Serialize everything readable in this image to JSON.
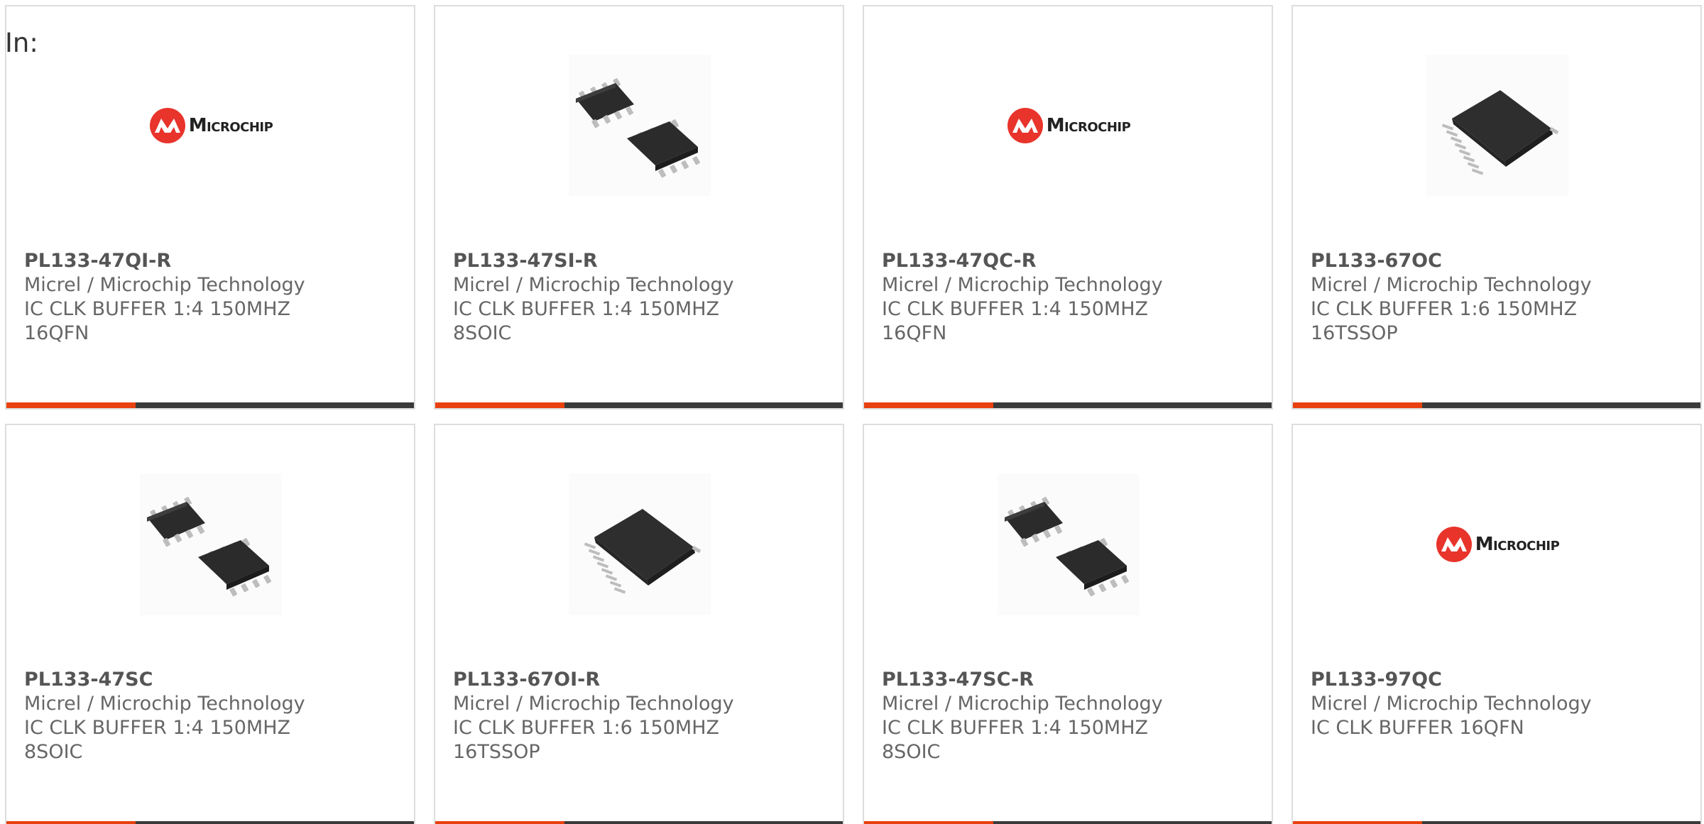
{
  "heading": "In:",
  "colors": {
    "accent": "#e8400f",
    "bar": "#3a3a3a",
    "border": "#dddddd",
    "text": "#666666"
  },
  "products": [
    {
      "part": "PL133-47QI-R",
      "manufacturer": "Micrel / Microchip Technology",
      "desc1": "IC CLK BUFFER 1:4 150MHZ",
      "desc2": "16QFN",
      "image": "microchip-logo",
      "logo_text": "Microchip"
    },
    {
      "part": "PL133-47SI-R",
      "manufacturer": "Micrel / Microchip Technology",
      "desc1": "IC CLK BUFFER 1:4 150MHZ",
      "desc2": "8SOIC",
      "image": "soic8-chip"
    },
    {
      "part": "PL133-47QC-R",
      "manufacturer": "Micrel / Microchip Technology",
      "desc1": "IC CLK BUFFER 1:4 150MHZ",
      "desc2": "16QFN",
      "image": "microchip-logo",
      "logo_text": "Microchip"
    },
    {
      "part": "PL133-67OC",
      "manufacturer": "Micrel / Microchip Technology",
      "desc1": "IC CLK BUFFER 1:6 150MHZ",
      "desc2": "16TSSOP",
      "image": "tssop16-chip"
    },
    {
      "part": "PL133-47SC",
      "manufacturer": "Micrel / Microchip Technology",
      "desc1": "IC CLK BUFFER 1:4 150MHZ",
      "desc2": "8SOIC",
      "image": "soic8-chip"
    },
    {
      "part": "PL133-67OI-R",
      "manufacturer": "Micrel / Microchip Technology",
      "desc1": "IC CLK BUFFER 1:6 150MHZ",
      "desc2": "16TSSOP",
      "image": "tssop16-chip"
    },
    {
      "part": "PL133-47SC-R",
      "manufacturer": "Micrel / Microchip Technology",
      "desc1": "IC CLK BUFFER 1:4 150MHZ",
      "desc2": "8SOIC",
      "image": "soic8-chip"
    },
    {
      "part": "PL133-97QC",
      "manufacturer": "Micrel / Microchip Technology",
      "desc1": "IC CLK BUFFER 16QFN",
      "desc2": "",
      "image": "microchip-logo",
      "logo_text": "Microchip"
    }
  ]
}
